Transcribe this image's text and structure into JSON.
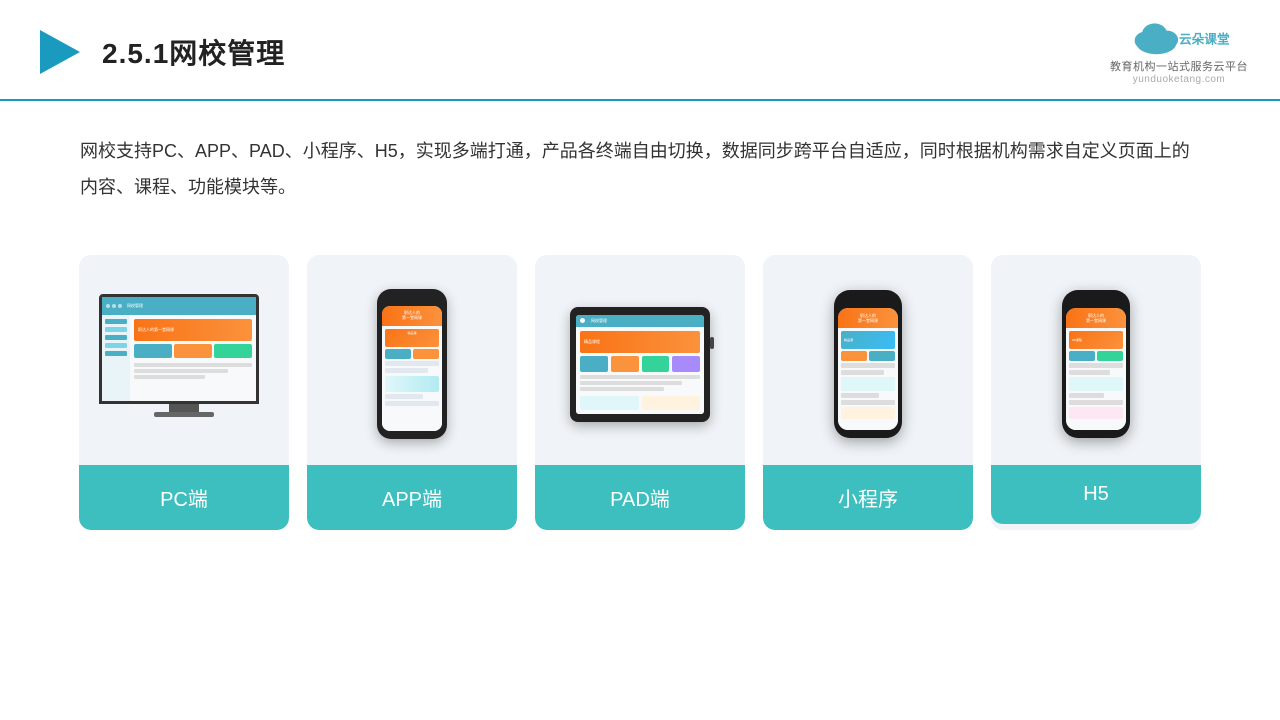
{
  "header": {
    "title": "2.5.1网校管理",
    "logo_name": "云朵课堂",
    "logo_url": "yunduoketang.com",
    "logo_tagline": "教育机构一站式服务云平台"
  },
  "description": {
    "text": "网校支持PC、APP、PAD、小程序、H5，实现多端打通，产品各终端自由切换，数据同步跨平台自适应，同时根据机构需求自定义页面上的内容、课程、功能模块等。"
  },
  "cards": [
    {
      "id": "pc",
      "label": "PC端"
    },
    {
      "id": "app",
      "label": "APP端"
    },
    {
      "id": "pad",
      "label": "PAD端"
    },
    {
      "id": "miniprogram",
      "label": "小程序"
    },
    {
      "id": "h5",
      "label": "H5"
    }
  ],
  "accent_color": "#3dbfbf",
  "title_color": "#222222"
}
